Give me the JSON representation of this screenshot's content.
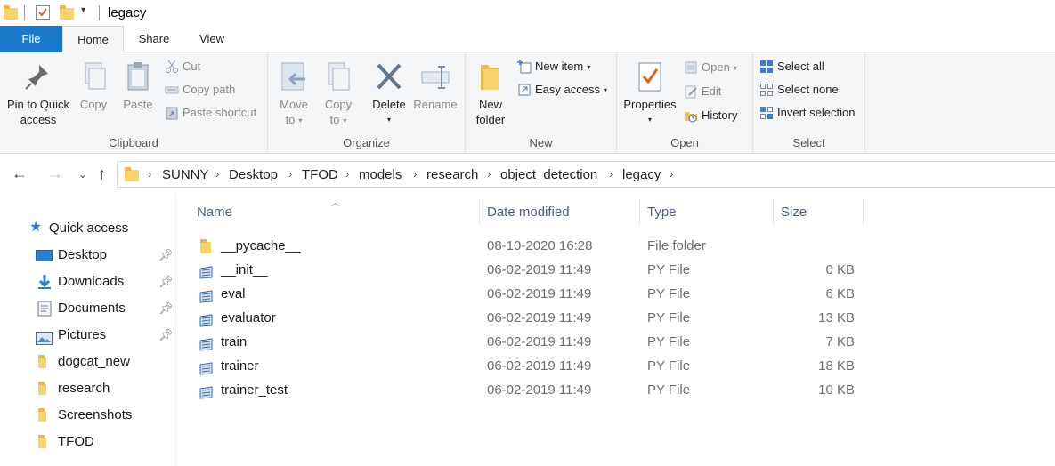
{
  "window": {
    "title": "legacy"
  },
  "ribbon_tabs": [
    "File",
    "Home",
    "Share",
    "View"
  ],
  "clipboard": {
    "pin_label": "Pin to Quick",
    "pin_label2": "access",
    "copy": "Copy",
    "paste": "Paste",
    "cut": "Cut",
    "copy_path": "Copy path",
    "paste_shortcut": "Paste shortcut",
    "group": "Clipboard"
  },
  "organize": {
    "move_to_1": "Move",
    "move_to_2": "to",
    "copy_to_1": "Copy",
    "copy_to_2": "to",
    "delete": "Delete",
    "rename": "Rename",
    "group": "Organize"
  },
  "new": {
    "new_folder_1": "New",
    "new_folder_2": "folder",
    "new_item": "New item",
    "easy_access": "Easy access",
    "group": "New"
  },
  "open": {
    "properties": "Properties",
    "open": "Open",
    "edit": "Edit",
    "history": "History",
    "group": "Open"
  },
  "select": {
    "select_all": "Select all",
    "select_none": "Select none",
    "invert": "Invert selection",
    "group": "Select"
  },
  "breadcrumb": [
    "SUNNY",
    "Desktop",
    "TFOD",
    "models",
    "research",
    "object_detection",
    "legacy"
  ],
  "sidebar": {
    "quick_access": "Quick access",
    "items": [
      {
        "label": "Desktop",
        "icon": "desktop-icon",
        "pinned": true
      },
      {
        "label": "Downloads",
        "icon": "download-icon",
        "pinned": true
      },
      {
        "label": "Documents",
        "icon": "documents-icon",
        "pinned": true
      },
      {
        "label": "Pictures",
        "icon": "pictures-icon",
        "pinned": true
      },
      {
        "label": "dogcat_new",
        "icon": "folder-icon",
        "pinned": false
      },
      {
        "label": "research",
        "icon": "folder-icon",
        "pinned": false
      },
      {
        "label": "Screenshots",
        "icon": "folder-icon",
        "pinned": false
      },
      {
        "label": "TFOD",
        "icon": "folder-icon",
        "pinned": false
      }
    ]
  },
  "columns": {
    "name": "Name",
    "date": "Date modified",
    "type": "Type",
    "size": "Size"
  },
  "files": [
    {
      "name": "__pycache__",
      "date": "08-10-2020 16:28",
      "type": "File folder",
      "size": "",
      "icon": "folder-icon"
    },
    {
      "name": "__init__",
      "date": "06-02-2019 11:49",
      "type": "PY File",
      "size": "0 KB",
      "icon": "python-file-icon"
    },
    {
      "name": "eval",
      "date": "06-02-2019 11:49",
      "type": "PY File",
      "size": "6 KB",
      "icon": "python-file-icon"
    },
    {
      "name": "evaluator",
      "date": "06-02-2019 11:49",
      "type": "PY File",
      "size": "13 KB",
      "icon": "python-file-icon"
    },
    {
      "name": "train",
      "date": "06-02-2019 11:49",
      "type": "PY File",
      "size": "7 KB",
      "icon": "python-file-icon"
    },
    {
      "name": "trainer",
      "date": "06-02-2019 11:49",
      "type": "PY File",
      "size": "18 KB",
      "icon": "python-file-icon"
    },
    {
      "name": "trainer_test",
      "date": "06-02-2019 11:49",
      "type": "PY File",
      "size": "10 KB",
      "icon": "python-file-icon"
    }
  ],
  "colors": {
    "file_tab": "#1979ca",
    "folder": "#f8d26a",
    "ribbon_bg": "#f5f6f7"
  }
}
